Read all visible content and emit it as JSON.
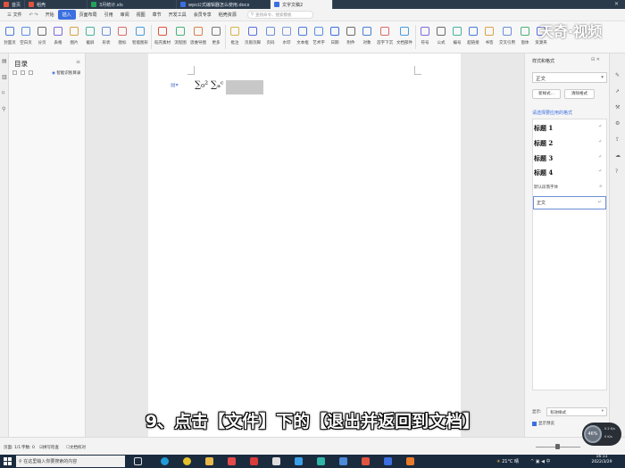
{
  "tabs": [
    {
      "label": "首页",
      "color": "#e0533f"
    },
    {
      "label": "稻壳",
      "color": "#e0533f"
    },
    {
      "label": "3月统计.xls",
      "color": "#24a35a"
    },
    {
      "label": "wps公式编辑器怎么使用.docx",
      "color": "#3b6fe0"
    },
    {
      "label": "文字文稿2",
      "color": "#3b6fe0"
    }
  ],
  "menubar": {
    "file": "三 文件",
    "items": [
      "开始",
      "插入",
      "页面布局",
      "引用",
      "审阅",
      "视图",
      "章节",
      "开发工具",
      "会员专享",
      "稻壳资源"
    ],
    "active": "插入",
    "search": "查找命令、搜索模板"
  },
  "ribbon": {
    "tools": [
      "封面页",
      "空白页",
      "分页",
      "表格",
      "图片",
      "截屏",
      "形状",
      "图标",
      "智能图形",
      "稻壳素材",
      "流程图",
      "思维导图",
      "更多",
      "批注",
      "页眉页脚",
      "页码",
      "水印",
      "文本框",
      "艺术字",
      "日期",
      "附件",
      "对象",
      "首字下沉",
      "文档部件",
      "符号",
      "公式",
      "编号",
      "超链接",
      "书签",
      "交叉引用",
      "窗体",
      "资源夹"
    ]
  },
  "toc": {
    "title": "目录",
    "smart_button": "智能识别目录"
  },
  "document": {
    "formula1": "∑₀²",
    "formula2": "∑ₐᶜ"
  },
  "style_panel": {
    "title": "样式和格式",
    "current_style": "正文",
    "new_style_button": "新样式...",
    "clear_format_button": "清除格式",
    "prompt": "请选择要应用的格式",
    "styles": [
      "标题 1",
      "标题 2",
      "标题 3",
      "标题 4"
    ],
    "default_font": "默认段落字体",
    "body_style": "正文",
    "display_label": "显示:",
    "display_value": "有效样式",
    "preview_label": "显示预览"
  },
  "status": {
    "page": "页面: 1/1",
    "word_count": "字数: 0",
    "spell_check": "拼写检查",
    "doc_check": "文档校对"
  },
  "taskbar": {
    "search_placeholder": "在这里输入你要搜索的内容",
    "weather": "21°C 晴",
    "time": "16:11",
    "date": "2022/3/29"
  },
  "progress": {
    "percent": "46%",
    "up": "0.2 K/s",
    "down": "0 K/s"
  },
  "subtitle": "9、点击【文件】下的【退出并返回到文档】",
  "watermark": "天奇·视频"
}
